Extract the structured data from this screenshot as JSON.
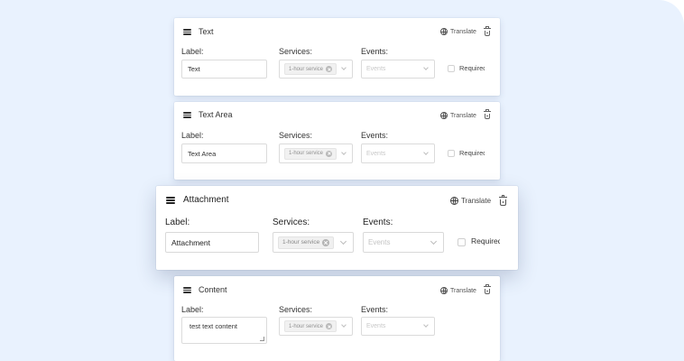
{
  "labels": {
    "label": "Label:",
    "services": "Services:",
    "events": "Events:",
    "translate": "Translate",
    "required": "Required",
    "events_placeholder": "Events",
    "service_tag": "1-hour service"
  },
  "cards": [
    {
      "title": "Text",
      "label_value": "Text",
      "has_required": true
    },
    {
      "title": "Text Area",
      "label_value": "Text Area",
      "has_required": true
    },
    {
      "title": "Attachment",
      "label_value": "Attachment",
      "has_required": true
    },
    {
      "title": "Content",
      "label_value": "test text content",
      "has_required": false
    }
  ],
  "colors": {
    "background": "#e9f2fe",
    "card": "#ffffff",
    "border": "#d9d9d9",
    "placeholder": "#c4c4c4"
  },
  "icons": [
    "drag-handle-icon",
    "globe-icon",
    "trash-icon",
    "tag-close-icon",
    "chevron-down-icon"
  ]
}
